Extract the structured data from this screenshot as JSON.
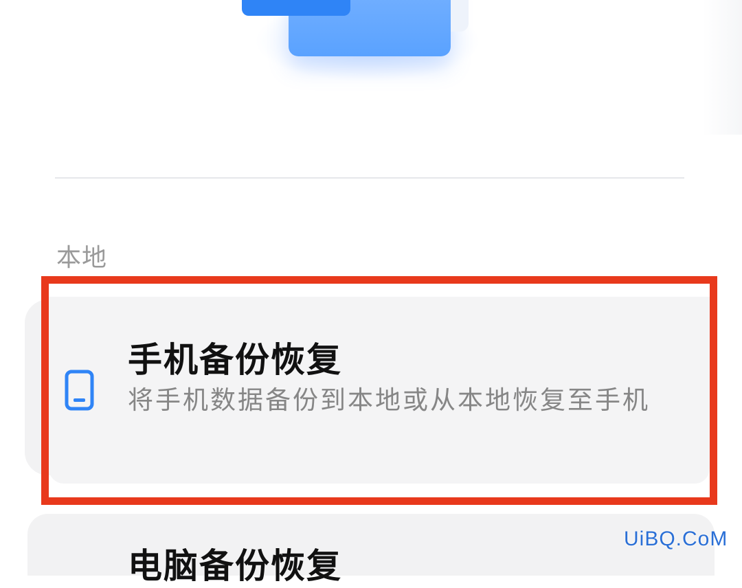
{
  "illustration": {
    "icon": "backup-illustration"
  },
  "section": {
    "label": "本地"
  },
  "items": [
    {
      "title": "手机备份恢复",
      "description": "将手机数据备份到本地或从本地恢复至手机",
      "icon": "phone-icon"
    },
    {
      "title": "电脑备份恢复"
    }
  ],
  "highlight": {
    "color": "#e8391c"
  },
  "accent_color": "#2f84f6",
  "watermark": "UiBQ.CoM"
}
